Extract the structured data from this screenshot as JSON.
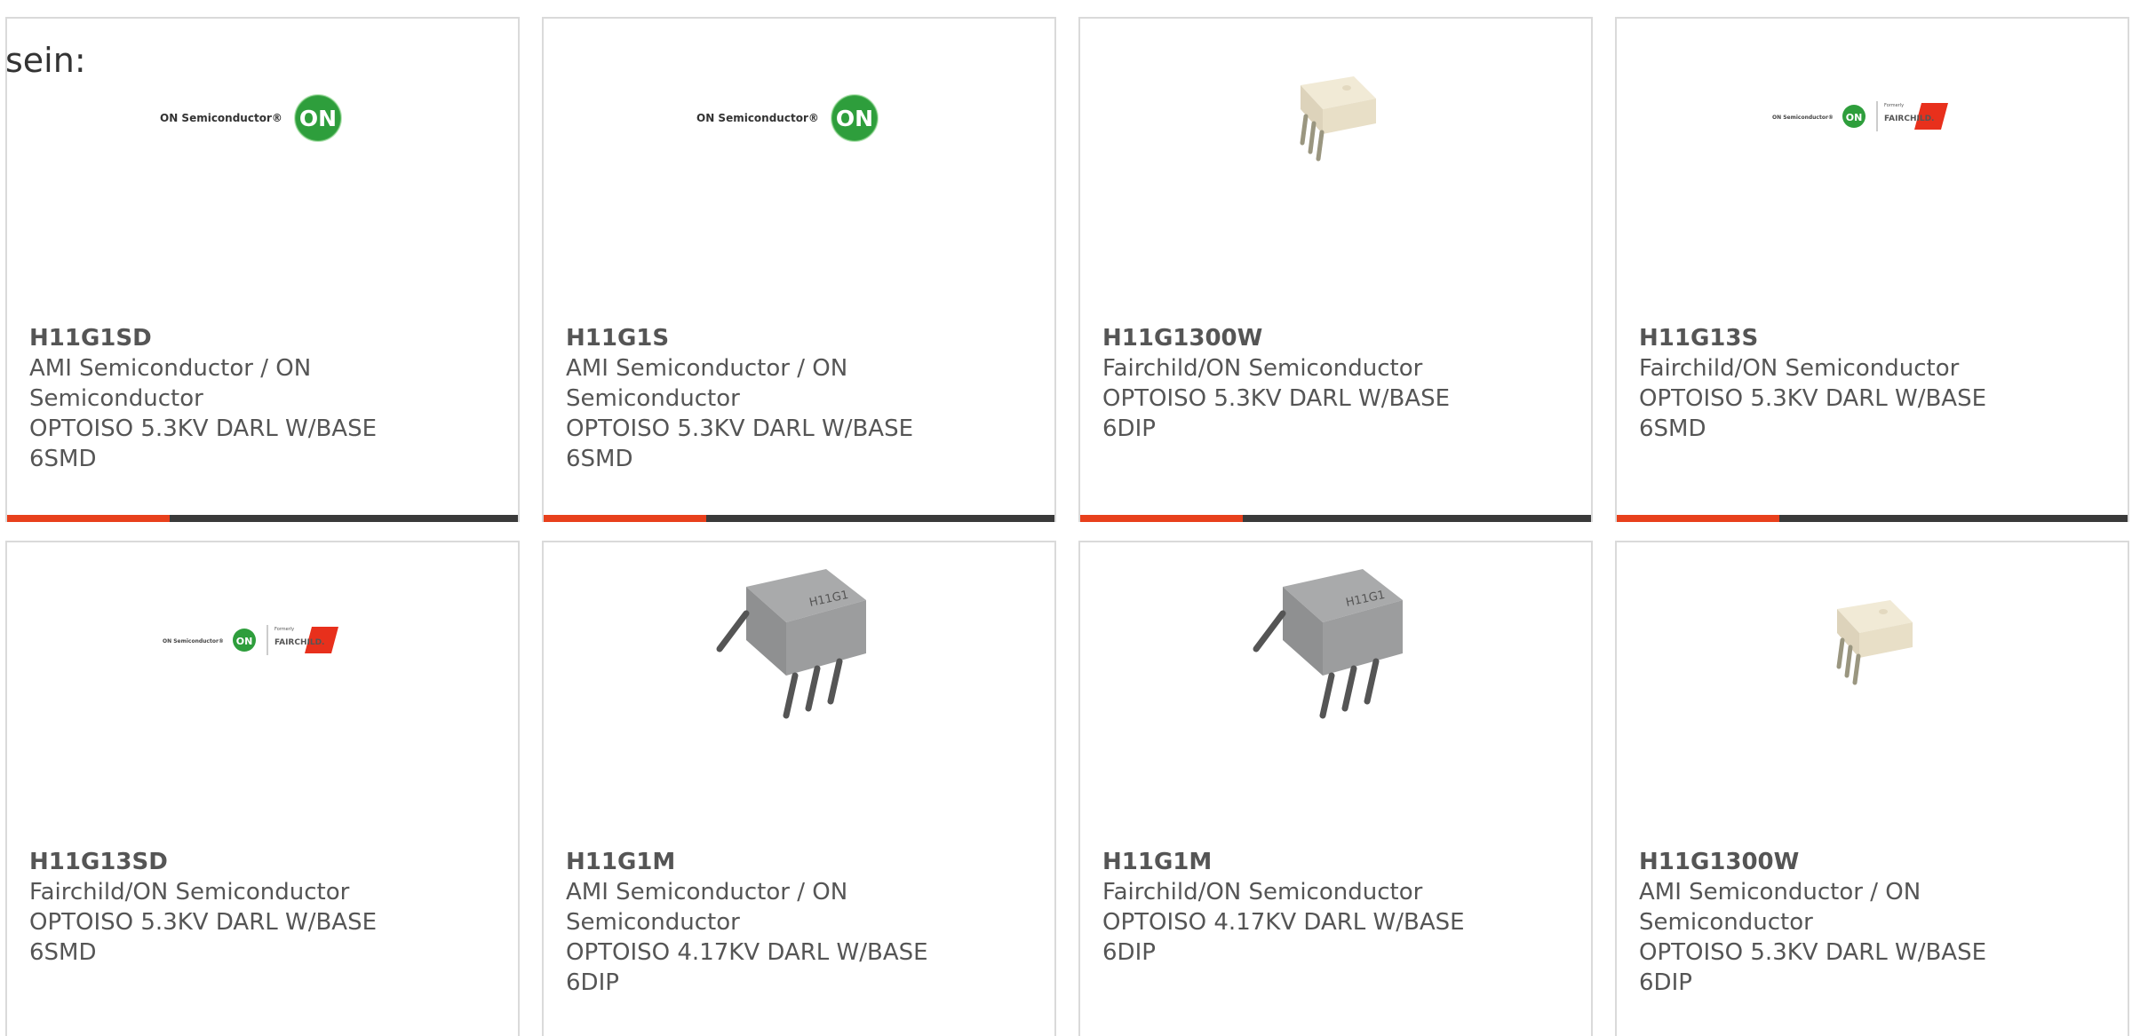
{
  "intro_text": "sein:",
  "colors": {
    "accent": "#e8401c",
    "bar": "#3a3a3a",
    "border": "#dadada",
    "text": "#555555",
    "on_green": "#2e9e3c",
    "fairchild_red": "#e8301c"
  },
  "products": [
    {
      "part": "H11G1SD",
      "manufacturer_lines": [
        "AMI Semiconductor / ON",
        "Semiconductor"
      ],
      "description_lines": [
        "OPTOISO 5.3KV DARL W/BASE",
        "6SMD"
      ],
      "image": "on-semiconductor-logo",
      "logo_text": "ON Semiconductor®",
      "logo_badge": "ON"
    },
    {
      "part": "H11G1S",
      "manufacturer_lines": [
        "AMI Semiconductor / ON",
        "Semiconductor"
      ],
      "description_lines": [
        "OPTOISO 5.3KV DARL W/BASE",
        "6SMD"
      ],
      "image": "on-semiconductor-logo",
      "logo_text": "ON Semiconductor®",
      "logo_badge": "ON"
    },
    {
      "part": "H11G1300W",
      "manufacturer_lines": [
        "Fairchild/ON Semiconductor"
      ],
      "description_lines": [
        "OPTOISO 5.3KV DARL W/BASE",
        "6DIP"
      ],
      "image": "white-dip-chip"
    },
    {
      "part": "H11G13S",
      "manufacturer_lines": [
        "Fairchild/ON Semiconductor"
      ],
      "description_lines": [
        "OPTOISO 5.3KV DARL W/BASE",
        "6SMD"
      ],
      "image": "on-fairchild-logo",
      "logo_text": "ON Semiconductor®",
      "logo_badge": "ON",
      "formerly_text": "Formerly",
      "fairchild_text": "FAIRCHILD."
    },
    {
      "part": "H11G13SD",
      "manufacturer_lines": [
        "Fairchild/ON Semiconductor"
      ],
      "description_lines": [
        "OPTOISO 5.3KV DARL W/BASE",
        "6SMD"
      ],
      "image": "on-fairchild-logo",
      "logo_text": "ON Semiconductor®",
      "logo_badge": "ON",
      "formerly_text": "Formerly",
      "fairchild_text": "FAIRCHILD."
    },
    {
      "part": "H11G1M",
      "manufacturer_lines": [
        "AMI Semiconductor / ON",
        "Semiconductor"
      ],
      "description_lines": [
        "OPTOISO 4.17KV DARL W/BASE",
        "6DIP"
      ],
      "image": "gray-dip-chip",
      "chip_marking": "H11G1"
    },
    {
      "part": "H11G1M",
      "manufacturer_lines": [
        "Fairchild/ON Semiconductor"
      ],
      "description_lines": [
        "OPTOISO 4.17KV DARL W/BASE",
        "6DIP"
      ],
      "image": "gray-dip-chip",
      "chip_marking": "H11G1"
    },
    {
      "part": "H11G1300W",
      "manufacturer_lines": [
        "AMI Semiconductor / ON",
        "Semiconductor"
      ],
      "description_lines": [
        "OPTOISO 5.3KV DARL W/BASE",
        "6DIP"
      ],
      "image": "white-dip-chip"
    }
  ]
}
